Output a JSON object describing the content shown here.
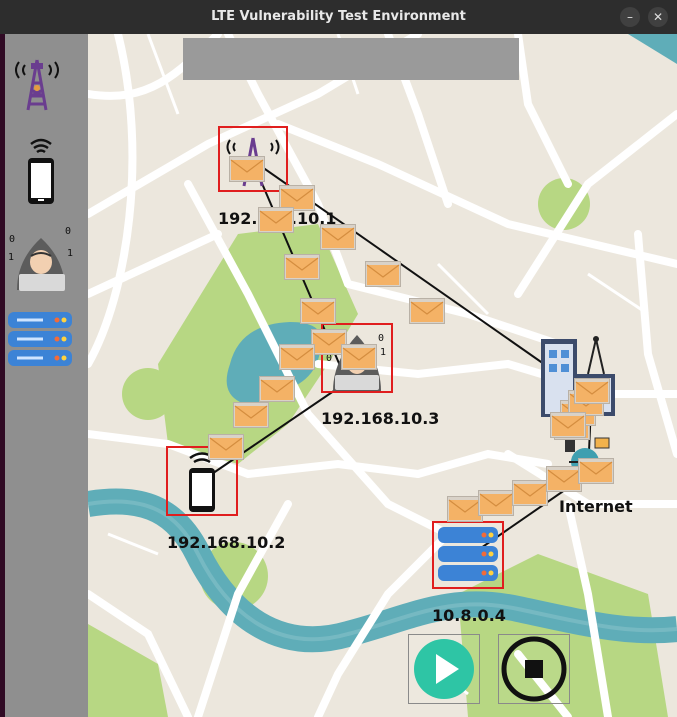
{
  "window": {
    "title": "LTE Vulnerability Test Environment",
    "minimize_glyph": "–",
    "close_glyph": "✕"
  },
  "palette": {
    "items": [
      {
        "name": "base-station-icon"
      },
      {
        "name": "phone-icon"
      },
      {
        "name": "hacker-icon"
      },
      {
        "name": "server-icon"
      }
    ]
  },
  "nodes": {
    "enb": {
      "label": "192.168.10.1",
      "icon": "base-station-icon"
    },
    "attacker": {
      "label": "192.168.10.3",
      "icon": "hacker-icon"
    },
    "ue": {
      "label": "192.168.10.2",
      "icon": "phone-icon"
    },
    "internet": {
      "label": "Internet",
      "icon": "building-antenna-icon"
    },
    "server": {
      "label": "10.8.0.4",
      "icon": "server-icon"
    }
  },
  "controls": {
    "play": "play-icon",
    "stop": "stop-icon"
  },
  "colors": {
    "map_bg": "#ece7dd",
    "park": "#b7d783",
    "water": "#5fadb8",
    "road": "#ffffff",
    "selection": "#e01e1e",
    "envelope": "#f4b266",
    "palette_bg": "#8f8f8f",
    "play": "#2ec5a5"
  }
}
